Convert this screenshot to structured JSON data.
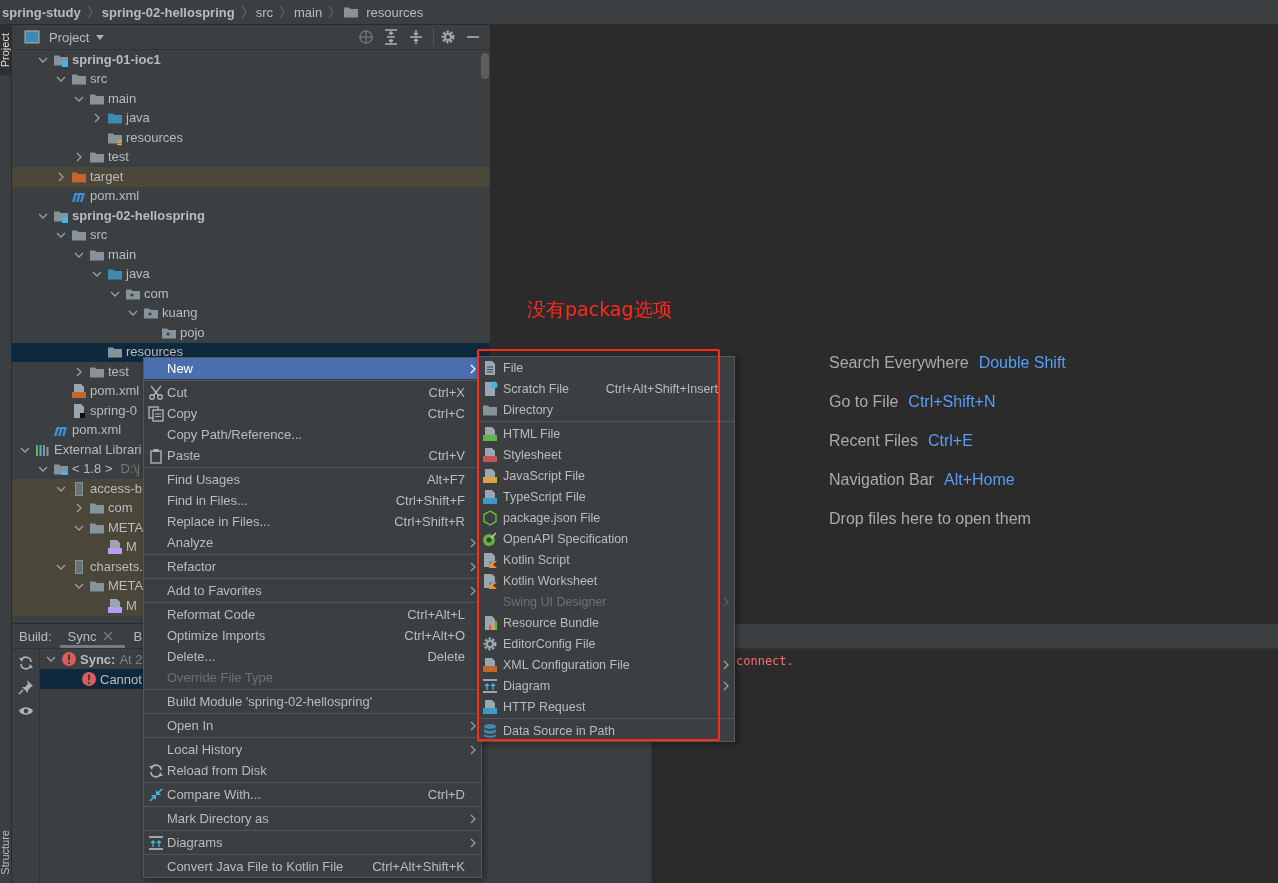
{
  "breadcrumb": [
    {
      "label": "spring-study",
      "kind": "module"
    },
    {
      "label": "spring-02-hellospring",
      "kind": "module"
    },
    {
      "label": "src",
      "kind": "dir"
    },
    {
      "label": "main",
      "kind": "dir"
    },
    {
      "label": "resources",
      "kind": "folder"
    }
  ],
  "side_tabs": [
    {
      "label": "Project",
      "selected": true
    },
    {
      "label": "Structure",
      "selected": false
    }
  ],
  "project_panel": {
    "title": "Project",
    "tree": [
      {
        "children": [
          {
            "label": "spring-01-ioc1",
            "kind": "module",
            "expanded": true,
            "selected": false,
            "tinted": false,
            "children": [
              {
                "label": "src",
                "kind": "folder",
                "expanded": true,
                "selected": false,
                "tinted": false,
                "children": [
                  {
                    "label": "main",
                    "kind": "folder",
                    "expanded": true,
                    "selected": false,
                    "tinted": false,
                    "children": [
                      {
                        "label": "java",
                        "kind": "source",
                        "expanded": false,
                        "selected": false,
                        "tinted": false
                      },
                      {
                        "label": "resources",
                        "kind": "resources",
                        "selected": false,
                        "tinted": false
                      }
                    ]
                  },
                  {
                    "label": "test",
                    "kind": "folder",
                    "expanded": false,
                    "selected": false,
                    "tinted": false
                  }
                ]
              },
              {
                "label": "target",
                "kind": "excluded",
                "expanded": false,
                "selected": false,
                "tinted": true
              },
              {
                "label": "pom.xml",
                "kind": "maven",
                "selected": false,
                "tinted": false
              }
            ]
          },
          {
            "label": "spring-02-hellospring",
            "kind": "module",
            "expanded": true,
            "selected": false,
            "tinted": false,
            "children": [
              {
                "label": "src",
                "kind": "folder",
                "expanded": true,
                "selected": false,
                "tinted": false,
                "children": [
                  {
                    "label": "main",
                    "kind": "folder",
                    "expanded": true,
                    "selected": false,
                    "tinted": false,
                    "children": [
                      {
                        "label": "java",
                        "kind": "source",
                        "expanded": true,
                        "selected": false,
                        "tinted": false,
                        "children": [
                          {
                            "label": "com",
                            "kind": "package",
                            "expanded": true,
                            "selected": false,
                            "tinted": false,
                            "children": [
                              {
                                "label": "kuang",
                                "kind": "package",
                                "expanded": true,
                                "selected": false,
                                "tinted": false,
                                "children": [
                                  {
                                    "label": "pojo",
                                    "kind": "package",
                                    "selected": false,
                                    "tinted": false
                                  }
                                ]
                              }
                            ]
                          }
                        ]
                      },
                      {
                        "label": "resources",
                        "kind": "folder",
                        "selected": true,
                        "tinted": false
                      }
                    ]
                  },
                  {
                    "label": "test",
                    "kind": "folder",
                    "expanded": false,
                    "selected": false,
                    "tinted": false
                  }
                ]
              },
              {
                "label": "pom.xml",
                "kind": "xml",
                "selected": false,
                "tinted": false
              },
              {
                "label": "spring-0",
                "kind": "iml",
                "selected": false,
                "tinted": false
              }
            ]
          },
          {
            "label": "pom.xml",
            "kind": "maven",
            "selected": false,
            "tinted": false
          }
        ]
      },
      {
        "label": "External Librari",
        "kind": "libraries",
        "expanded": true,
        "selected": false,
        "tinted": false,
        "children": [
          {
            "label": "< 1.8 >",
            "hint": "D:\\j",
            "kind": "jdk",
            "expanded": true,
            "selected": false,
            "tinted": false,
            "children": [
              {
                "label": "access-b",
                "kind": "jar",
                "expanded": true,
                "selected": false,
                "tinted": true,
                "children": [
                  {
                    "label": "com",
                    "kind": "folder",
                    "expanded": false,
                    "selected": false,
                    "tinted": true
                  },
                  {
                    "label": "META",
                    "kind": "folder",
                    "expanded": true,
                    "selected": false,
                    "tinted": true,
                    "children": [
                      {
                        "label": "M",
                        "kind": "manifest",
                        "selected": false,
                        "tinted": true
                      }
                    ]
                  }
                ]
              },
              {
                "label": "charsets.",
                "kind": "jar",
                "expanded": true,
                "selected": false,
                "tinted": true,
                "children": [
                  {
                    "label": "META",
                    "kind": "folder",
                    "expanded": true,
                    "selected": false,
                    "tinted": true,
                    "children": [
                      {
                        "label": "M",
                        "kind": "manifest",
                        "selected": false,
                        "tinted": true
                      }
                    ]
                  }
                ]
              }
            ]
          }
        ]
      }
    ]
  },
  "editor_hints": [
    {
      "action": "Search Everywhere",
      "shortcut": "Double Shift"
    },
    {
      "action": "Go to File",
      "shortcut": "Ctrl+Shift+N"
    },
    {
      "action": "Recent Files",
      "shortcut": "Ctrl+E"
    },
    {
      "action": "Navigation Bar",
      "shortcut": "Alt+Home"
    },
    {
      "action": "Drop files here to open them"
    }
  ],
  "annotation": {
    "text": "没有packag选项"
  },
  "build_panel": {
    "label": "Build:",
    "tabs": [
      {
        "label": "Sync",
        "selected": true,
        "closable": true
      },
      {
        "label": "B",
        "selected": false,
        "closable": false
      }
    ],
    "tree": [
      {
        "label": "Sync:",
        "detail": "At 2",
        "expanded": true,
        "selected": false,
        "children": [
          {
            "label": "Cannot",
            "selected": true
          }
        ]
      }
    ],
    "console": [
      "connect."
    ]
  },
  "context_menu": {
    "items": [
      {
        "kind": "plain",
        "label": "New",
        "submenu": true,
        "selected": true,
        "disabled": false
      },
      {
        "kind": "separator"
      },
      {
        "kind": "cut",
        "label": "Cut",
        "shortcut": "Ctrl+X",
        "submenu": false,
        "selected": false,
        "disabled": false
      },
      {
        "kind": "copy",
        "label": "Copy",
        "shortcut": "Ctrl+C",
        "submenu": false,
        "selected": false,
        "disabled": false
      },
      {
        "kind": "plain",
        "label": "Copy Path/Reference...",
        "submenu": false,
        "selected": false,
        "disabled": false
      },
      {
        "kind": "paste",
        "label": "Paste",
        "shortcut": "Ctrl+V",
        "submenu": false,
        "selected": false,
        "disabled": false
      },
      {
        "kind": "separator"
      },
      {
        "kind": "plain",
        "label": "Find Usages",
        "shortcut": "Alt+F7",
        "submenu": false,
        "selected": false,
        "disabled": false
      },
      {
        "kind": "plain",
        "label": "Find in Files...",
        "shortcut": "Ctrl+Shift+F",
        "submenu": false,
        "selected": false,
        "disabled": false
      },
      {
        "kind": "plain",
        "label": "Replace in Files...",
        "shortcut": "Ctrl+Shift+R",
        "submenu": false,
        "selected": false,
        "disabled": false
      },
      {
        "kind": "plain",
        "label": "Analyze",
        "submenu": true,
        "selected": false,
        "disabled": false
      },
      {
        "kind": "separator"
      },
      {
        "kind": "plain",
        "label": "Refactor",
        "submenu": true,
        "selected": false,
        "disabled": false
      },
      {
        "kind": "separator"
      },
      {
        "kind": "plain",
        "label": "Add to Favorites",
        "submenu": true,
        "selected": false,
        "disabled": false
      },
      {
        "kind": "separator"
      },
      {
        "kind": "plain",
        "label": "Reformat Code",
        "shortcut": "Ctrl+Alt+L",
        "submenu": false,
        "selected": false,
        "disabled": false
      },
      {
        "kind": "plain",
        "label": "Optimize Imports",
        "shortcut": "Ctrl+Alt+O",
        "submenu": false,
        "selected": false,
        "disabled": false
      },
      {
        "kind": "plain",
        "label": "Delete...",
        "shortcut": "Delete",
        "submenu": false,
        "selected": false,
        "disabled": false
      },
      {
        "kind": "plain",
        "label": "Override File Type",
        "submenu": false,
        "selected": false,
        "disabled": true
      },
      {
        "kind": "separator"
      },
      {
        "kind": "plain",
        "label": "Build Module 'spring-02-hellospring'",
        "submenu": false,
        "selected": false,
        "disabled": false
      },
      {
        "kind": "separator"
      },
      {
        "kind": "plain",
        "label": "Open In",
        "submenu": true,
        "selected": false,
        "disabled": false
      },
      {
        "kind": "separator"
      },
      {
        "kind": "plain",
        "label": "Local History",
        "submenu": true,
        "selected": false,
        "disabled": false
      },
      {
        "kind": "reload",
        "label": "Reload from Disk",
        "submenu": false,
        "selected": false,
        "disabled": false
      },
      {
        "kind": "separator"
      },
      {
        "kind": "compare",
        "label": "Compare With...",
        "shortcut": "Ctrl+D",
        "submenu": false,
        "selected": false,
        "disabled": false
      },
      {
        "kind": "separator"
      },
      {
        "kind": "plain",
        "label": "Mark Directory as",
        "submenu": true,
        "selected": false,
        "disabled": false
      },
      {
        "kind": "separator"
      },
      {
        "kind": "diagram",
        "label": "Diagrams",
        "submenu": true,
        "selected": false,
        "disabled": false
      },
      {
        "kind": "separator"
      },
      {
        "kind": "plain",
        "label": "Convert Java File to Kotlin File",
        "shortcut": "Ctrl+Alt+Shift+K",
        "submenu": false,
        "selected": false,
        "disabled": false
      }
    ]
  },
  "new_submenu": {
    "items": [
      {
        "kind": "file",
        "label": "File",
        "submenu": false,
        "selected": false,
        "disabled": false
      },
      {
        "kind": "scratch",
        "label": "Scratch File",
        "shortcut": "Ctrl+Alt+Shift+Insert",
        "submenu": false,
        "selected": false,
        "disabled": false
      },
      {
        "kind": "directory",
        "label": "Directory",
        "submenu": false,
        "selected": false,
        "disabled": false
      },
      {
        "kind": "separator"
      },
      {
        "kind": "html",
        "label": "HTML File",
        "submenu": false,
        "selected": false,
        "disabled": false
      },
      {
        "kind": "css",
        "label": "Stylesheet",
        "submenu": false,
        "selected": false,
        "disabled": false
      },
      {
        "kind": "js",
        "label": "JavaScript File",
        "submenu": false,
        "selected": false,
        "disabled": false
      },
      {
        "kind": "ts",
        "label": "TypeScript File",
        "submenu": false,
        "selected": false,
        "disabled": false
      },
      {
        "kind": "node",
        "label": "package.json File",
        "submenu": false,
        "selected": false,
        "disabled": false
      },
      {
        "kind": "openapi",
        "label": "OpenAPI Specification",
        "submenu": false,
        "selected": false,
        "disabled": false
      },
      {
        "kind": "kotlin",
        "label": "Kotlin Script",
        "submenu": false,
        "selected": false,
        "disabled": false
      },
      {
        "kind": "kotlin",
        "label": "Kotlin Worksheet",
        "submenu": false,
        "selected": false,
        "disabled": false
      },
      {
        "kind": "plain",
        "label": "Swing UI Designer",
        "submenu": true,
        "selected": false,
        "disabled": true
      },
      {
        "kind": "bundle",
        "label": "Resource Bundle",
        "submenu": false,
        "selected": false,
        "disabled": false
      },
      {
        "kind": "gear",
        "label": "EditorConfig File",
        "submenu": false,
        "selected": false,
        "disabled": false
      },
      {
        "kind": "xml",
        "label": "XML Configuration File",
        "submenu": true,
        "selected": false,
        "disabled": false
      },
      {
        "kind": "diagram",
        "label": "Diagram",
        "submenu": true,
        "selected": false,
        "disabled": false
      },
      {
        "kind": "api",
        "label": "HTTP Request",
        "submenu": false,
        "selected": false,
        "disabled": false
      },
      {
        "kind": "separator"
      },
      {
        "kind": "database",
        "label": "Data Source in Path",
        "submenu": false,
        "selected": false,
        "disabled": false
      }
    ]
  }
}
